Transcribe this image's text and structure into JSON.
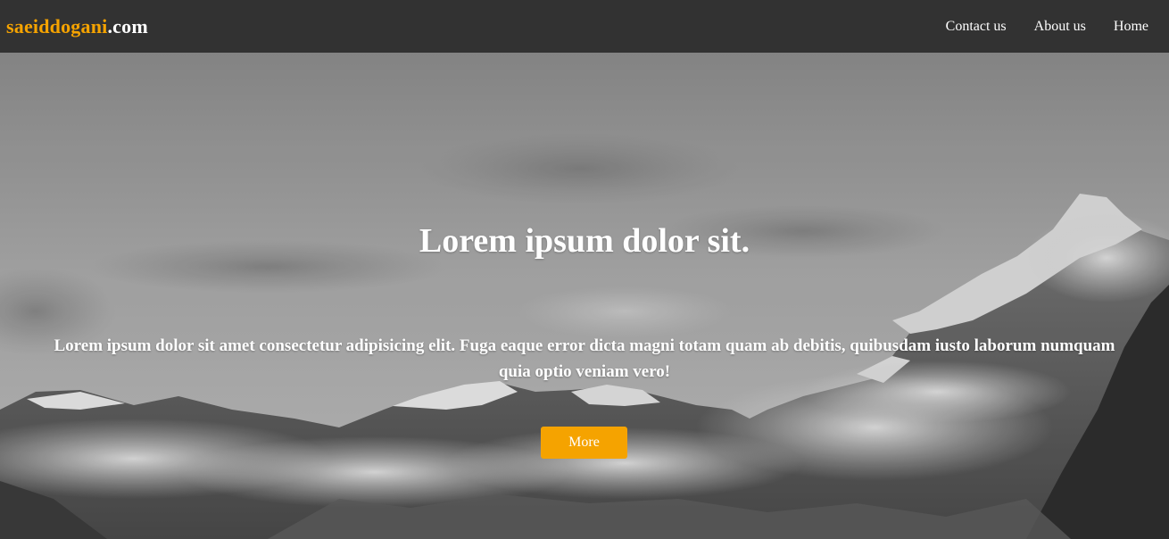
{
  "header": {
    "logo_brand": "saeiddogani",
    "logo_tld": ".com",
    "nav": [
      "Contact us",
      "About us",
      "Home"
    ]
  },
  "hero": {
    "title": "Lorem ipsum dolor sit.",
    "text": "Lorem ipsum dolor sit amet consectetur adipisicing elit. Fuga eaque error dicta magni totam quam ab debitis, quibusdam iusto laborum numquam quia optio veniam vero!",
    "button_label": "More"
  },
  "colors": {
    "navbar_bg": "#323232",
    "accent": "#f5a300",
    "text": "#ffffff"
  }
}
